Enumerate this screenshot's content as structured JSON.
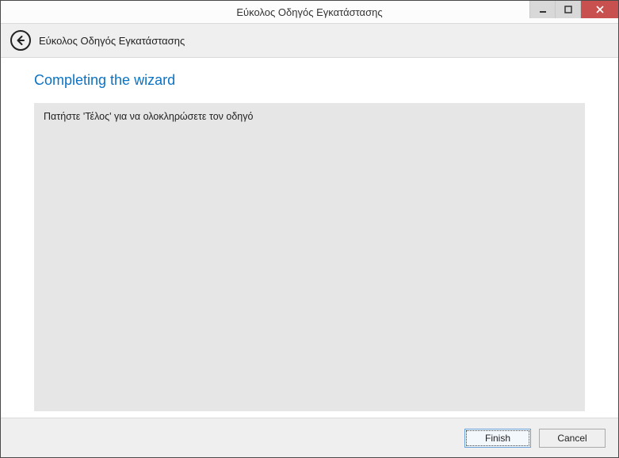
{
  "window": {
    "title": "Εύκολος Οδηγός Εγκατάστασης"
  },
  "subheader": {
    "title": "Εύκολος Οδηγός Εγκατάστασης"
  },
  "page": {
    "heading": "Completing the wizard",
    "body": "Πατήστε 'Τέλος' για να ολοκληρώσετε τον οδηγό"
  },
  "footer": {
    "finish_label": "Finish",
    "cancel_label": "Cancel"
  }
}
